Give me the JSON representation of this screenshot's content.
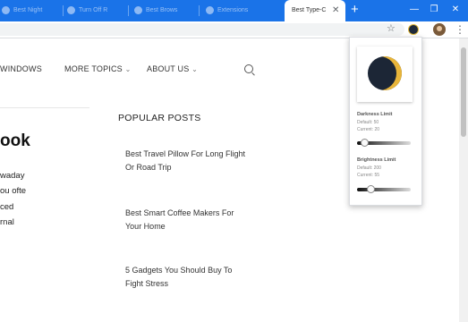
{
  "browser": {
    "tabs": [
      {
        "label": "Best Night"
      },
      {
        "label": "Turn Off R"
      },
      {
        "label": "Best Brows"
      },
      {
        "label": "Extensions"
      }
    ],
    "active_tab": {
      "label": "Best Type-C",
      "close": "✕"
    },
    "new_tab": "+",
    "window_controls": {
      "minimize": "—",
      "restore": "❐",
      "close": "✕"
    },
    "toolbar": {
      "star": "☆",
      "menu": "⋮"
    }
  },
  "site_nav": {
    "items": [
      {
        "label": "WINDOWS"
      },
      {
        "label": "MORE TOPICS",
        "chevron": "⌄"
      },
      {
        "label": "ABOUT US",
        "chevron": "⌄"
      }
    ]
  },
  "article": {
    "title_fragment": "ook",
    "lines": [
      "waday",
      "ou ofte",
      "ced",
      "rnal"
    ]
  },
  "popular_posts": {
    "heading": "POPULAR POSTS",
    "posts": [
      {
        "title": "Best Travel Pillow For Long Flight Or Road Trip"
      },
      {
        "title": "Best Smart Coffee Makers For Your Home"
      },
      {
        "title": "5 Gadgets You Should Buy To Fight Stress"
      }
    ]
  },
  "extension_popup": {
    "darkness": {
      "label": "Darkness Limit",
      "default": "Default: 50",
      "current": "Current: 20",
      "value": 20
    },
    "brightness": {
      "label": "Brightness Limit",
      "default": "Default: 200",
      "current": "Current: 55",
      "value": 55
    }
  },
  "colors": {
    "tab_strip": "#1a73e8",
    "moon_dark": "#1c2636",
    "moon_light": "#e8b53a"
  },
  "icons": [
    "star-icon",
    "night-mode-extension-icon",
    "profile-avatar",
    "menu-dots-icon",
    "search-icon",
    "moon-icon",
    "chevron-down-icon"
  ]
}
